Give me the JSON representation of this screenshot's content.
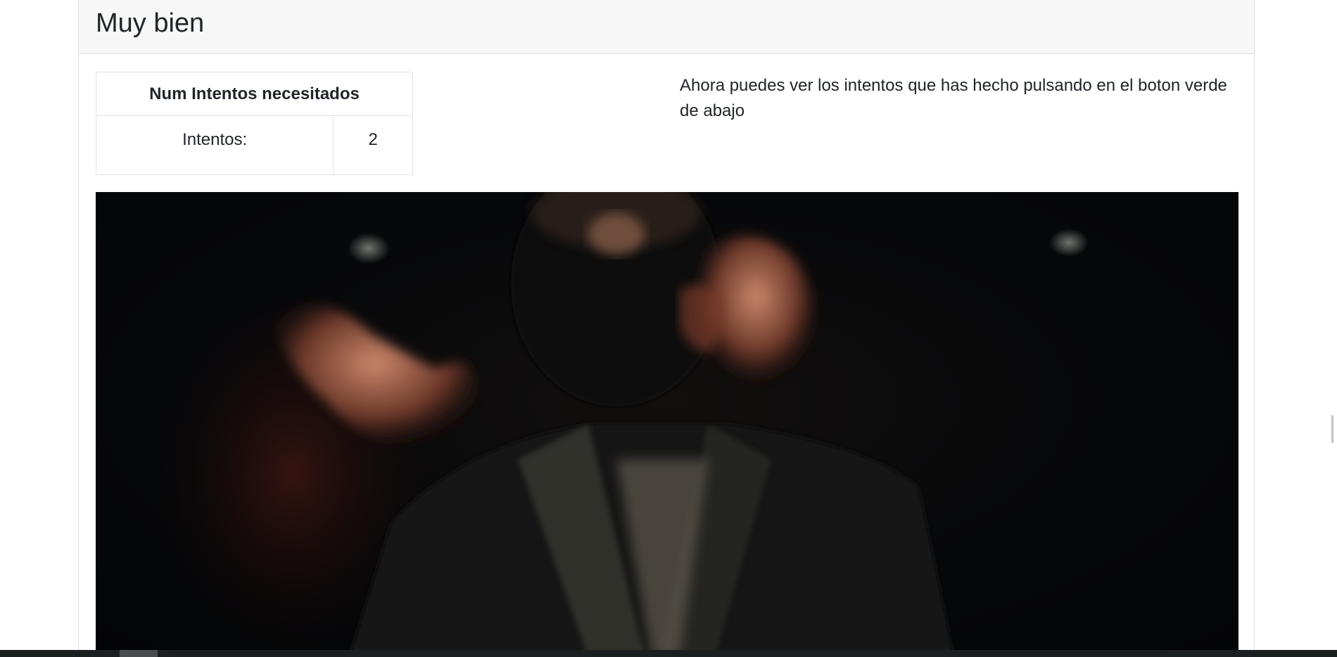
{
  "card": {
    "title": "Muy bien"
  },
  "attempts_table": {
    "header": "Num Intentos necesitados",
    "row_label": "Intentos:",
    "row_value": "2"
  },
  "info": {
    "text": "Ahora puedes ver los intentos que has hecho pulsando en el boton verde de abajo"
  },
  "media": {
    "description_icon": "video-frame-image"
  },
  "colors": {
    "header_bg": "#f7f7f7",
    "border": "#dee2e6",
    "text": "#212529",
    "taskbar": "#1c1f1f"
  }
}
